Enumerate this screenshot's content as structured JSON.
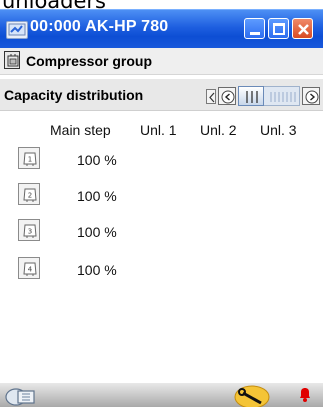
{
  "caption": "unloaders",
  "window": {
    "title": "00:000 AK-HP 780",
    "buttons": {
      "minimize": "minimize",
      "maximize": "maximize",
      "close": "close"
    }
  },
  "section": {
    "title": "Compressor group"
  },
  "subsection": {
    "title": "Capacity distribution",
    "slider_position_fraction": 0.0
  },
  "table": {
    "columns": [
      "Main step",
      "Unl. 1",
      "Unl. 2",
      "Unl. 3"
    ],
    "rows": [
      {
        "index": "1",
        "main_step": "100 %"
      },
      {
        "index": "2",
        "main_step": "100 %"
      },
      {
        "index": "3",
        "main_step": "100 %"
      },
      {
        "index": "4",
        "main_step": "100 %"
      }
    ]
  },
  "colors": {
    "titlebar": "#1e5fe0",
    "background": "#ffffff",
    "alarm": "#e00000"
  },
  "icons": {
    "app": "device-monitor-icon",
    "group": "compressor-group-icon",
    "step": "compressor-step-icon",
    "status_left": "network-device-icon",
    "status_tool": "wrench-icon",
    "status_alarm": "alarm-bell-icon"
  }
}
